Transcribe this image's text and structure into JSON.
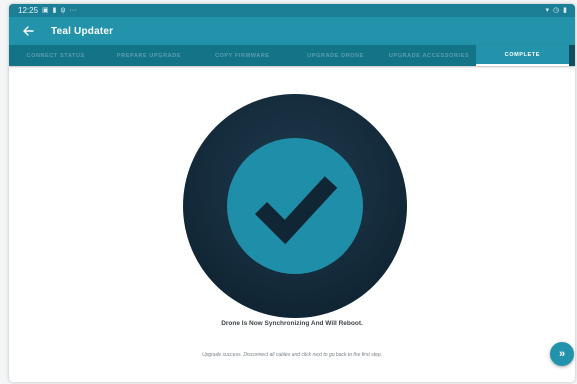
{
  "statusbar": {
    "time": "12:25",
    "left_icons": [
      "image-icon",
      "sim-icon",
      "usb-icon",
      "more-icon"
    ],
    "right_icons": [
      "wifi-icon",
      "alarm-icon",
      "battery-icon"
    ]
  },
  "appbar": {
    "back_icon": "arrow-left-icon",
    "title": "Teal Updater"
  },
  "tabs": [
    {
      "label": "Connect Status",
      "active": false
    },
    {
      "label": "Prepare Upgrade",
      "active": false
    },
    {
      "label": "Copy Firmware",
      "active": false
    },
    {
      "label": "Upgrade Drone",
      "active": false
    },
    {
      "label": "Upgrade Accessories",
      "active": false
    },
    {
      "label": "COMPLETE",
      "active": true
    }
  ],
  "main": {
    "badge_icon": "checkmark-icon",
    "status_message": "Drone Is Now Synchronizing And Will Reboot.",
    "hint_message": "Upgrade success. Disconnect all cables and click next to go back to the first step.",
    "next_button_icon": "double-chevron-right-icon",
    "next_button_glyph": "»"
  },
  "colors": {
    "primary": "#2393ab",
    "primary_dark": "#147487",
    "badge_dark": "#142b3b",
    "check_color": "#112634"
  }
}
